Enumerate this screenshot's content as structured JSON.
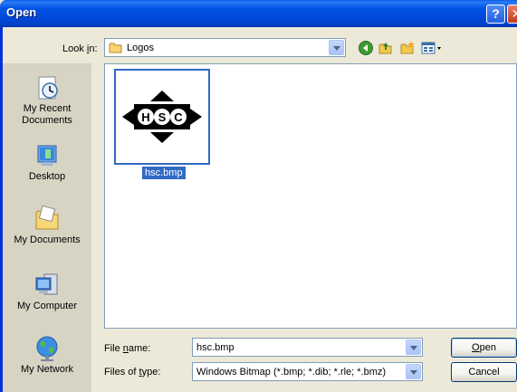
{
  "window": {
    "title": "Open"
  },
  "lookin": {
    "label_pre": "Look ",
    "label_u": "i",
    "label_post": "n:",
    "value": "Logos"
  },
  "places": [
    {
      "label": "My Recent Documents",
      "icon": "recent-documents-icon"
    },
    {
      "label": "Desktop",
      "icon": "desktop-icon"
    },
    {
      "label": "My Documents",
      "icon": "my-documents-icon"
    },
    {
      "label": "My Computer",
      "icon": "my-computer-icon"
    },
    {
      "label": "My Network",
      "icon": "my-network-icon"
    }
  ],
  "files": [
    {
      "name": "hsc.bmp",
      "selected": true,
      "logo_letters": [
        "H",
        "S",
        "C"
      ]
    }
  ],
  "filename": {
    "label_pre": "File ",
    "label_u": "n",
    "label_post": "ame:",
    "value": "hsc.bmp"
  },
  "filetype": {
    "label_pre": "Files of ",
    "label_u": "t",
    "label_post": "ype:",
    "value": "Windows Bitmap (*.bmp; *.dib; *.rle; *.bmz)"
  },
  "buttons": {
    "open_u": "O",
    "open_rest": "pen",
    "cancel": "Cancel"
  },
  "titlebar_buttons": {
    "help": "?",
    "close": "✕"
  },
  "colors": {
    "titlebar": "#0054E3",
    "selection": "#316AC5",
    "dialog_bg": "#ECE9D8"
  }
}
